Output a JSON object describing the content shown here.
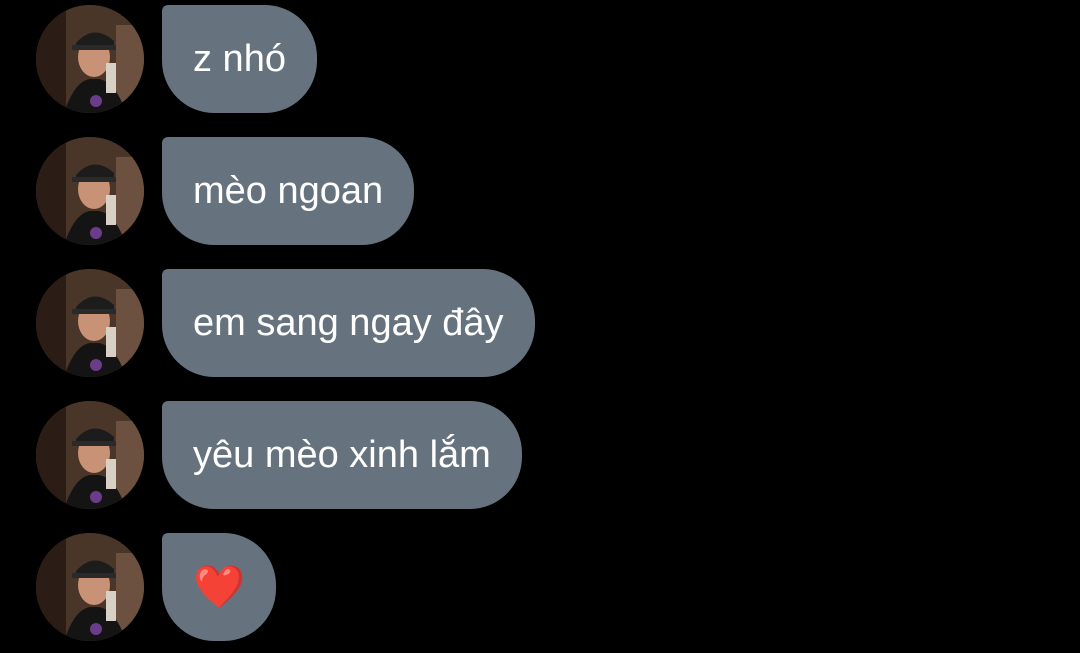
{
  "messages": [
    {
      "text": "z nhó"
    },
    {
      "text": "mèo ngoan"
    },
    {
      "text": "em sang ngay đây"
    },
    {
      "text": "yêu mèo xinh lắm"
    },
    {
      "text": "❤️"
    }
  ],
  "colors": {
    "background": "#000000",
    "bubble": "#66737f",
    "bubble_text": "#ffffff",
    "heart": "#e53935"
  },
  "icons": {
    "avatar": "user-avatar-photo"
  }
}
